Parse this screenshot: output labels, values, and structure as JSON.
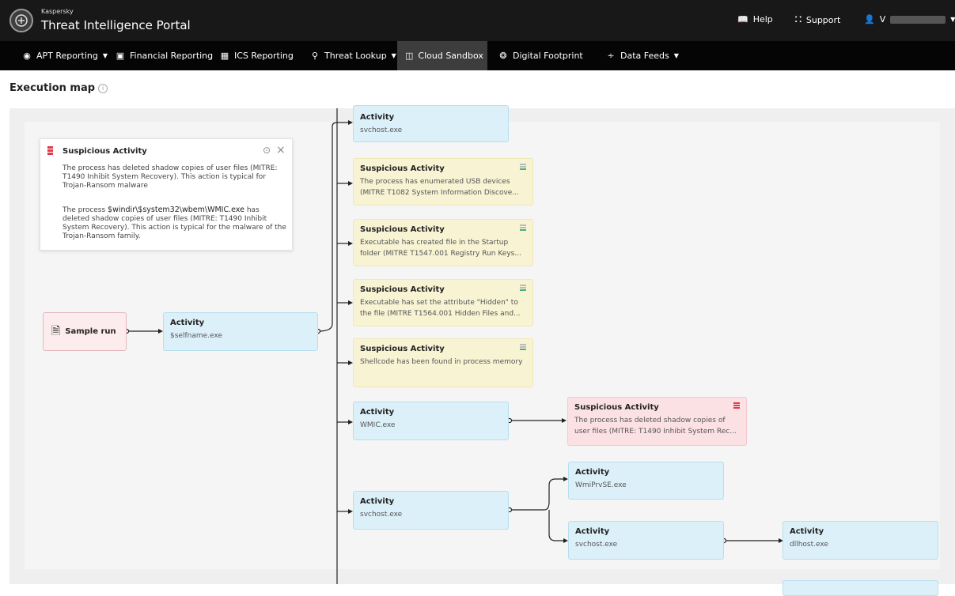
{
  "header": {
    "brand_small": "Kaspersky",
    "brand_title": "Threat Intelligence Portal",
    "help": "Help",
    "support": "Support",
    "user": "V"
  },
  "nav": {
    "apt": "APT Reporting",
    "financial": "Financial Reporting",
    "ics": "ICS Reporting",
    "threat": "Threat Lookup",
    "sandbox": "Cloud Sandbox",
    "footprint": "Digital Footprint",
    "feeds": "Data Feeds"
  },
  "page": {
    "title": "Execution map"
  },
  "tooltip": {
    "title": "Suspicious Activity",
    "p1": "The process has deleted shadow copies of user files (MITRE: T1490 Inhibit System Recovery). This action is typical for Trojan-Ransom malware",
    "p2a": "The process ",
    "p2b": "$windir\\$system32\\wbem\\WMIC.exe",
    "p2c": " has deleted shadow copies of user files (MITRE: T1490 Inhibit System Recovery). This action is typical for the malware of the Trojan-Ransom family."
  },
  "sample": {
    "label": "Sample run"
  },
  "nodes": {
    "root": {
      "title": "Activity",
      "desc": "$selfname.exe"
    },
    "a1": {
      "title": "Activity",
      "desc": "svchost.exe"
    },
    "s1": {
      "title": "Suspicious Activity",
      "desc": "The process has enumerated USB devices (MITRE T1082 System Information Discove..."
    },
    "s2": {
      "title": "Suspicious Activity",
      "desc": "Executable has created file in the Startup folder (MITRE T1547.001 Registry Run Keys..."
    },
    "s3": {
      "title": "Suspicious Activity",
      "desc": "Executable has set the attribute \"Hidden\" to the file (MITRE T1564.001 Hidden Files and..."
    },
    "s4": {
      "title": "Suspicious Activity",
      "desc": "Shellcode has been found in process memory"
    },
    "wmic": {
      "title": "Activity",
      "desc": "WMIC.exe"
    },
    "sred": {
      "title": "Suspicious Activity",
      "desc": "The process has deleted shadow copies of user files (MITRE: T1490 Inhibit System Rec..."
    },
    "svc2": {
      "title": "Activity",
      "desc": "svchost.exe"
    },
    "wmiprv": {
      "title": "Activity",
      "desc": "WmiPrvSE.exe"
    },
    "svc3": {
      "title": "Activity",
      "desc": "svchost.exe"
    },
    "dll": {
      "title": "Activity",
      "desc": "dllhost.exe"
    }
  },
  "colors": {
    "activity_bg": "#dcf0f9",
    "suspicious_bg": "#f7f3d3",
    "danger_bg": "#fbe1e4",
    "severity_red": "#e03a4b",
    "severity_green": "#47b37a"
  }
}
